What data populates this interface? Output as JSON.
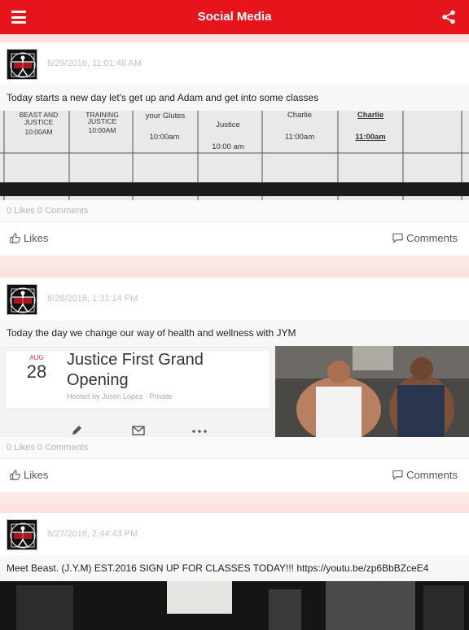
{
  "header": {
    "title": "Social Media"
  },
  "posts": [
    {
      "timestamp": "8/29/2016, 11:01:48 AM",
      "text": "Today starts a new day let's get up and Adam and get into some classes",
      "media": {
        "cells": [
          "BEAST AND",
          "JUSTICE",
          "10:00AM",
          "TRAINING",
          "JUSTICE",
          "10:00AM",
          "your Glutes",
          "10:00am",
          "Justice",
          "10:00 am",
          "Charlie",
          "11:00am",
          "Charlie",
          "11:00am"
        ]
      },
      "counts": "0 Likes 0 Comments",
      "likes_label": "Likes",
      "comments_label": "Comments"
    },
    {
      "timestamp": "8/28/2016, 1:31:14 PM",
      "text": "Today the day we change our way of health and wellness with JYM",
      "media": {
        "month": "AUG",
        "day": "28",
        "event_title_1": "Justice First Grand",
        "event_title_2": "Opening",
        "hosted_by": "Hosted by Justin Lopez · Private"
      },
      "counts": "0 Likes 0 Comments",
      "likes_label": "Likes",
      "comments_label": "Comments"
    },
    {
      "timestamp": "8/27/2016, 2:44:43 PM",
      "text": "Meet Beast. (J.Y.M) EST.2016 SIGN UP FOR CLASSES TODAY!!! https://youtu.be/zp6BbBZceE4"
    }
  ]
}
